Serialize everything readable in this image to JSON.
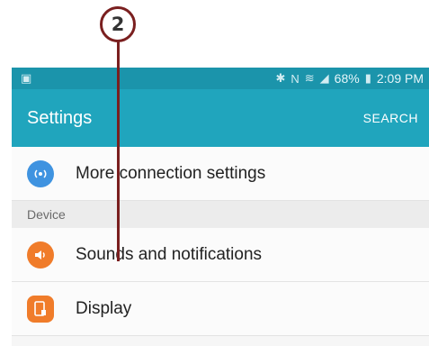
{
  "callout": {
    "number": "2"
  },
  "statusbar": {
    "left_icon": "gallery-icon",
    "bluetooth_glyph": "✱",
    "nfc_glyph": "N",
    "wifi_glyph": "≋",
    "signal_glyph": "◢",
    "battery_percent": "68%",
    "battery_glyph": "▮",
    "time": "2:09 PM"
  },
  "appbar": {
    "title": "Settings",
    "search_label": "SEARCH"
  },
  "rows": {
    "more_connection": {
      "label": "More connection settings",
      "icon": "wireless-icon",
      "icon_glyph": "((•))"
    },
    "device_section": "Device",
    "sounds": {
      "label": "Sounds and notifications",
      "icon": "speaker-icon",
      "icon_glyph": "◀)"
    },
    "display": {
      "label": "Display",
      "icon": "display-icon",
      "icon_glyph": "◧"
    }
  },
  "colors": {
    "statusbar": "#1b94ab",
    "appbar": "#20a5bd",
    "icon_blue": "#3f93e0",
    "icon_orange": "#f07c2a",
    "callout": "#7a1f1f"
  }
}
